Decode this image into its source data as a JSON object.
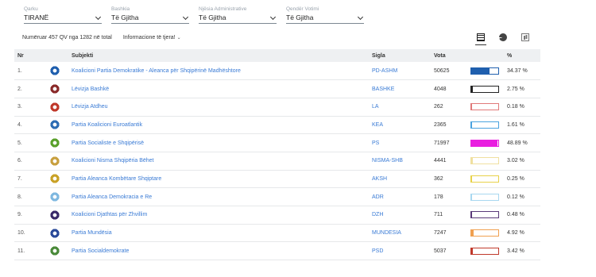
{
  "filters": [
    {
      "label": "Qarku",
      "value": "TIRANË"
    },
    {
      "label": "Bashkia",
      "value": "Të Gjitha"
    },
    {
      "label": "Njësia Administrative",
      "value": "Të Gjitha"
    },
    {
      "label": "Qendër Votimi",
      "value": "Të Gjitha"
    }
  ],
  "info": {
    "counted": "Numëruar 457 QV nga 1282 në total",
    "more": "Informacione të tjera!",
    "more_chevron": "⌄"
  },
  "view_icons": [
    "table-icon",
    "pie-chart-icon",
    "bar-chart-icon"
  ],
  "table": {
    "headers": {
      "nr": "Nr",
      "subject": "Subjekti",
      "sigla": "Sigla",
      "vota": "Vota",
      "pct": "%"
    },
    "rows": [
      {
        "nr": "1.",
        "subject": "Koalicioni Partia Demokratike - Aleanca për Shqipërinë Madhështore",
        "sigla": "PD-ASHM",
        "vota": "50625",
        "pct": "34.37 %",
        "share": 0.3437,
        "color": "#1f5fae",
        "logo_color": "#1f5fae"
      },
      {
        "nr": "2.",
        "subject": "Lëvizja Bashkë",
        "sigla": "BASHKE",
        "vota": "4048",
        "pct": "2.75 %",
        "share": 0.0275,
        "color": "#222222",
        "logo_color": "#8a2a2a"
      },
      {
        "nr": "3.",
        "subject": "Lëvizja Atdheu",
        "sigla": "LA",
        "vota": "262",
        "pct": "0.18 %",
        "share": 0.0018,
        "color": "#e07a7a",
        "logo_color": "#c0392b"
      },
      {
        "nr": "4.",
        "subject": "Partia Koalicioni Euroatlantik",
        "sigla": "KEA",
        "vota": "2365",
        "pct": "1.61 %",
        "share": 0.0161,
        "color": "#4aa3df",
        "logo_color": "#2e6db4"
      },
      {
        "nr": "5.",
        "subject": "Partia Socialiste e Shqipërisë",
        "sigla": "PS",
        "vota": "71997",
        "pct": "48.89 %",
        "share": 0.4889,
        "color": "#e91ee0",
        "logo_color": "#5aa02c"
      },
      {
        "nr": "6.",
        "subject": "Koalicioni Nisma Shqipëria Bëhet",
        "sigla": "NISMA-SHB",
        "vota": "4441",
        "pct": "3.02 %",
        "share": 0.0302,
        "color": "#f0e0a0",
        "logo_color": "#c8a040"
      },
      {
        "nr": "7.",
        "subject": "Partia Aleanca Kombëtare Shqiptare",
        "sigla": "AKSH",
        "vota": "362",
        "pct": "0.25 %",
        "share": 0.0025,
        "color": "#e8d24a",
        "logo_color": "#c9a227"
      },
      {
        "nr": "8.",
        "subject": "Partia Aleanca Demokracia e Re",
        "sigla": "ADR",
        "vota": "178",
        "pct": "0.12 %",
        "share": 0.0012,
        "color": "#a8d8f0",
        "logo_color": "#7fb8e0"
      },
      {
        "nr": "9.",
        "subject": "Koalicioni Djathtas për Zhvillim",
        "sigla": "DZH",
        "vota": "711",
        "pct": "0.48 %",
        "share": 0.0048,
        "color": "#5a3a7a",
        "logo_color": "#3a2a6a"
      },
      {
        "nr": "10.",
        "subject": "Partia Mundësia",
        "sigla": "MUNDESIA",
        "vota": "7247",
        "pct": "4.92 %",
        "share": 0.0492,
        "color": "#f0a050",
        "logo_color": "#2a4a9a"
      },
      {
        "nr": "11.",
        "subject": "Partia Socialdemokrate",
        "sigla": "PSD",
        "vota": "5037",
        "pct": "3.42 %",
        "share": 0.0342,
        "color": "#c0392b",
        "logo_color": "#4a8a3a"
      }
    ]
  }
}
